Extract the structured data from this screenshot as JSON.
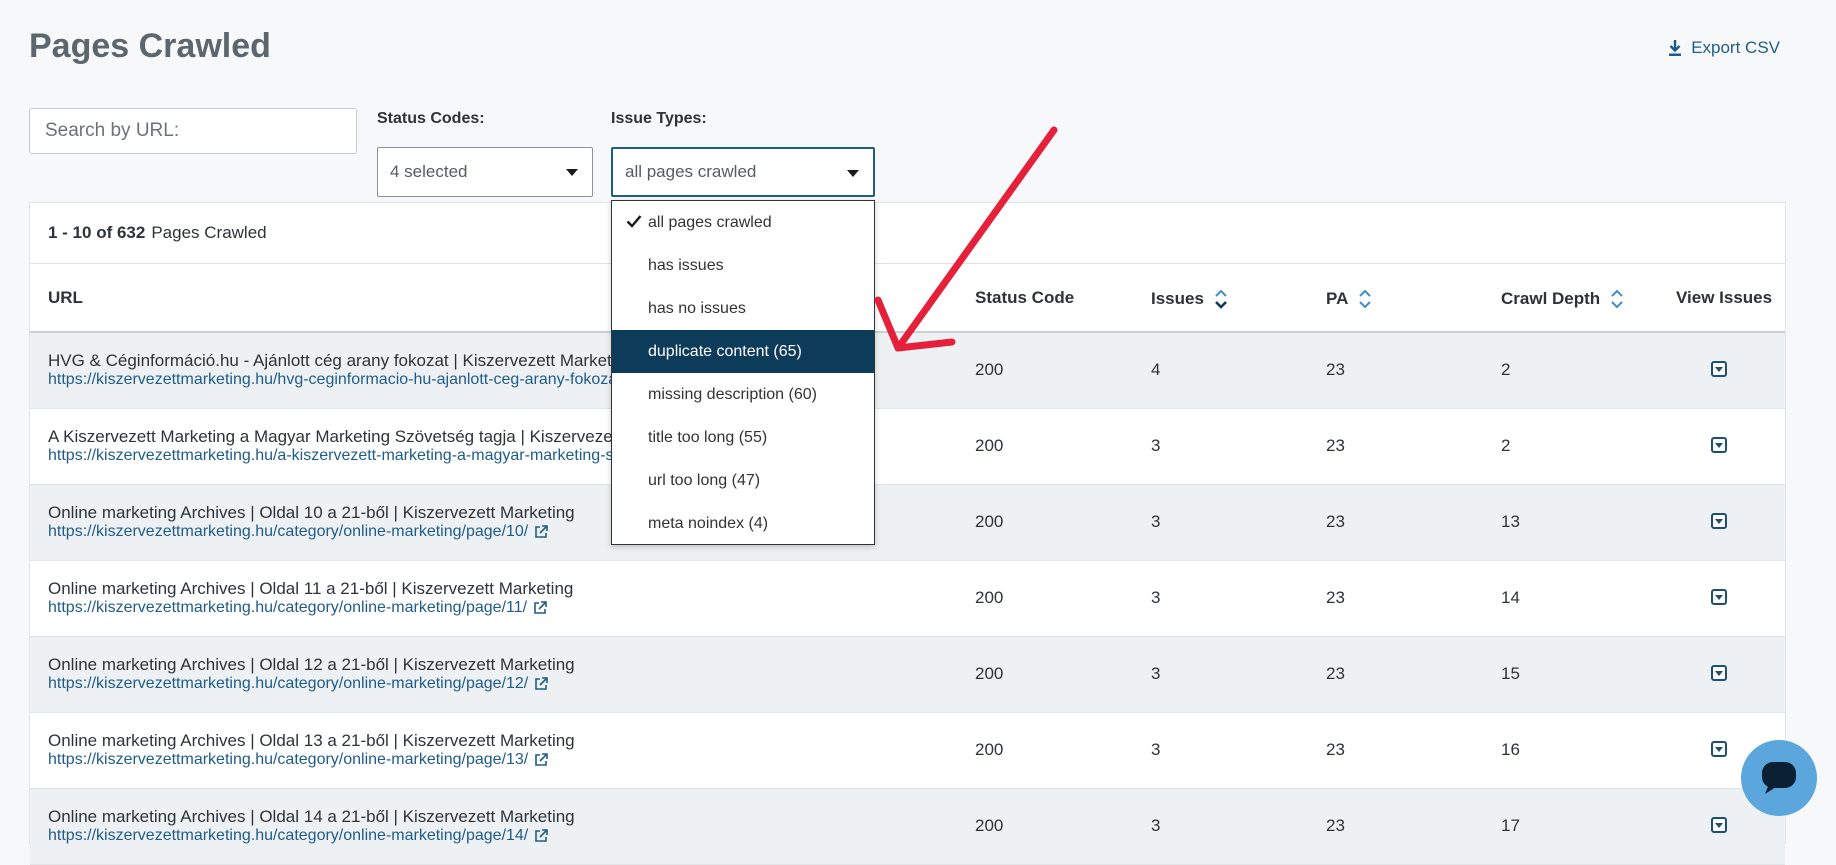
{
  "header": {
    "title": "Pages Crawled",
    "export_label": "Export CSV"
  },
  "filters": {
    "search_placeholder": "Search by URL:",
    "status_codes": {
      "label": "Status Codes:",
      "value": "4 selected"
    },
    "issue_types": {
      "label": "Issue Types:",
      "value": "all pages crawled",
      "options": [
        "all pages crawled",
        "has issues",
        "has no issues",
        "duplicate content (65)",
        "missing description (60)",
        "title too long (55)",
        "url too long (47)",
        "meta noindex (4)"
      ],
      "checked_index": 0,
      "highlighted_index": 3
    }
  },
  "summary": {
    "range": "1 - 10 of 632",
    "label": "Pages Crawled"
  },
  "table": {
    "columns": [
      "URL",
      "Status Code",
      "Issues",
      "PA",
      "Crawl Depth",
      "View Issues"
    ],
    "rows": [
      {
        "title": "HVG & Céginformáció.hu - Ajánlott cég arany fokozat | Kiszervezett Marketing",
        "url": "https://kiszervezettmarketing.hu/hvg-ceginformacio-hu-ajanlott-ceg-arany-fokozat/",
        "status": "200",
        "issues": "4",
        "pa": "23",
        "depth": "2"
      },
      {
        "title": "A Kiszervezett Marketing a Magyar Marketing Szövetség tagja | Kiszervezett Marketing",
        "url": "https://kiszervezettmarketing.hu/a-kiszervezett-marketing-a-magyar-marketing-szovetseg-tagja/",
        "status": "200",
        "issues": "3",
        "pa": "23",
        "depth": "2"
      },
      {
        "title": "Online marketing Archives | Oldal 10 a 21-ből | Kiszervezett Marketing",
        "url": "https://kiszervezettmarketing.hu/category/online-marketing/page/10/",
        "status": "200",
        "issues": "3",
        "pa": "23",
        "depth": "13"
      },
      {
        "title": "Online marketing Archives | Oldal 11 a 21-ből | Kiszervezett Marketing",
        "url": "https://kiszervezettmarketing.hu/category/online-marketing/page/11/",
        "status": "200",
        "issues": "3",
        "pa": "23",
        "depth": "14"
      },
      {
        "title": "Online marketing Archives | Oldal 12 a 21-ből | Kiszervezett Marketing",
        "url": "https://kiszervezettmarketing.hu/category/online-marketing/page/12/",
        "status": "200",
        "issues": "3",
        "pa": "23",
        "depth": "15"
      },
      {
        "title": "Online marketing Archives | Oldal 13 a 21-ből | Kiszervezett Marketing",
        "url": "https://kiszervezettmarketing.hu/category/online-marketing/page/13/",
        "status": "200",
        "issues": "3",
        "pa": "23",
        "depth": "16"
      },
      {
        "title": "Online marketing Archives | Oldal 14 a 21-ből | Kiszervezett Marketing",
        "url": "https://kiszervezettmarketing.hu/category/online-marketing/page/14/",
        "status": "200",
        "issues": "3",
        "pa": "23",
        "depth": "17"
      }
    ]
  },
  "colors": {
    "accent": "#1f5c8a",
    "highlight": "#0d3c5a",
    "annotation": "#e5203a",
    "chat": "#5aa6dd"
  },
  "icons": [
    "download-icon",
    "chevron-down-icon",
    "sort-icon",
    "external-link-icon",
    "checkmark-icon",
    "chat-icon"
  ]
}
